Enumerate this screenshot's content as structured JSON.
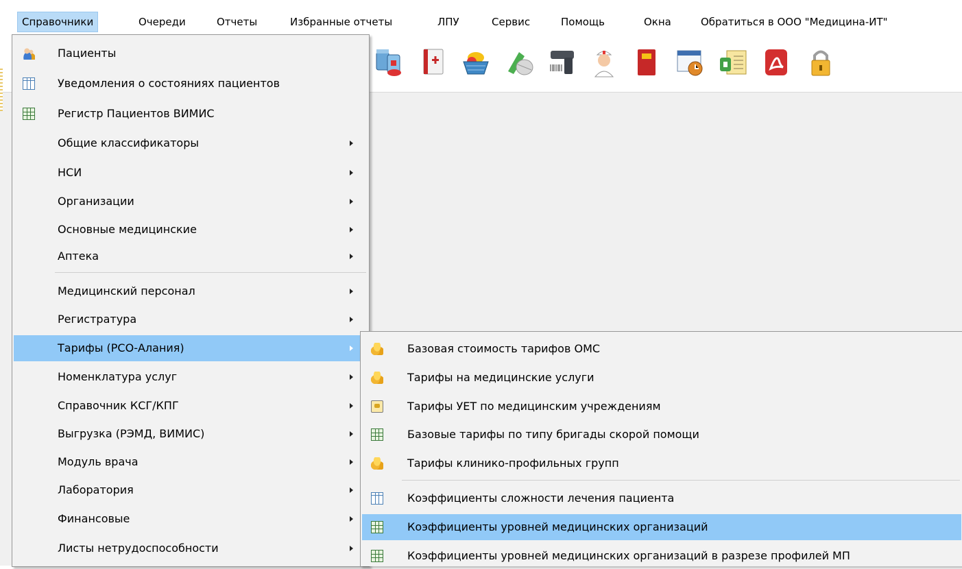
{
  "menubar": {
    "items": [
      {
        "label": "Справочники"
      },
      {
        "label": "Очереди"
      },
      {
        "label": "Отчеты"
      },
      {
        "label": "Избранные отчеты"
      },
      {
        "label": "ЛПУ"
      },
      {
        "label": "Сервис"
      },
      {
        "label": "Помощь"
      },
      {
        "label": "Окна"
      },
      {
        "label": "Обратиться в ООО \"Медицина-ИТ\""
      }
    ]
  },
  "toolbar": {
    "icons": [
      "pills-icon",
      "medical-book-icon",
      "pills-basket-icon",
      "capsule-icon",
      "barcode-scanner-icon",
      "nurse-icon",
      "red-book-icon",
      "schedule-icon",
      "documents-icon",
      "pdf-icon",
      "lock-icon"
    ]
  },
  "main_menu": {
    "items": [
      {
        "label": "Пациенты",
        "icon": "patients-icon"
      },
      {
        "label": "Уведомления о состояниях пациентов",
        "icon": "table-columns-icon"
      },
      {
        "label": "Регистр Пациентов ВИМИС",
        "icon": "grid-icon"
      },
      {
        "label": "Общие классификаторы",
        "submenu": true
      },
      {
        "label": "НСИ",
        "submenu": true
      },
      {
        "label": "Организации",
        "submenu": true
      },
      {
        "label": "Основные медицинские",
        "submenu": true
      },
      {
        "label": "Аптека",
        "submenu": true
      },
      {
        "label": "Медицинский персонал",
        "submenu": true
      },
      {
        "label": "Регистратура",
        "submenu": true
      },
      {
        "label": "Тарифы (РСО-Алания)",
        "submenu": true,
        "highlighted": true
      },
      {
        "label": "Номенклатура услуг",
        "submenu": true
      },
      {
        "label": "Справочник КСГ/КПГ",
        "submenu": true
      },
      {
        "label": "Выгрузка (РЭМД, ВИМИС)",
        "submenu": true
      },
      {
        "label": "Модуль врача",
        "submenu": true
      },
      {
        "label": "Лаборатория",
        "submenu": true
      },
      {
        "label": "Финансовые",
        "submenu": true
      },
      {
        "label": "Листы нетрудоспособности",
        "submenu": true
      }
    ]
  },
  "sub_menu": {
    "items": [
      {
        "label": "Базовая стоимость тарифов ОМС",
        "icon": "coins-icon"
      },
      {
        "label": "Тарифы на медицинские услуги",
        "icon": "coins-icon"
      },
      {
        "label": "Тарифы УЕТ по медицинским учреждениям",
        "icon": "calculator-icon"
      },
      {
        "label": "Базовые тарифы по типу бригады скорой помощи",
        "icon": "grid-icon"
      },
      {
        "label": "Тарифы клинико-профильных групп",
        "icon": "coins-icon"
      },
      {
        "label": "Коэффициенты сложности лечения пациента",
        "icon": "table-columns-icon"
      },
      {
        "label": "Коэффициенты уровней медицинских организаций",
        "icon": "grid-icon",
        "highlighted": true
      },
      {
        "label": "Коэффициенты уровней медицинских организаций в разрезе профилей МП",
        "icon": "grid-icon"
      }
    ]
  },
  "colors": {
    "menu_bg": "#f2f2f2",
    "highlight": "#91c9f7",
    "menubar_active": "#b9dbf7"
  }
}
